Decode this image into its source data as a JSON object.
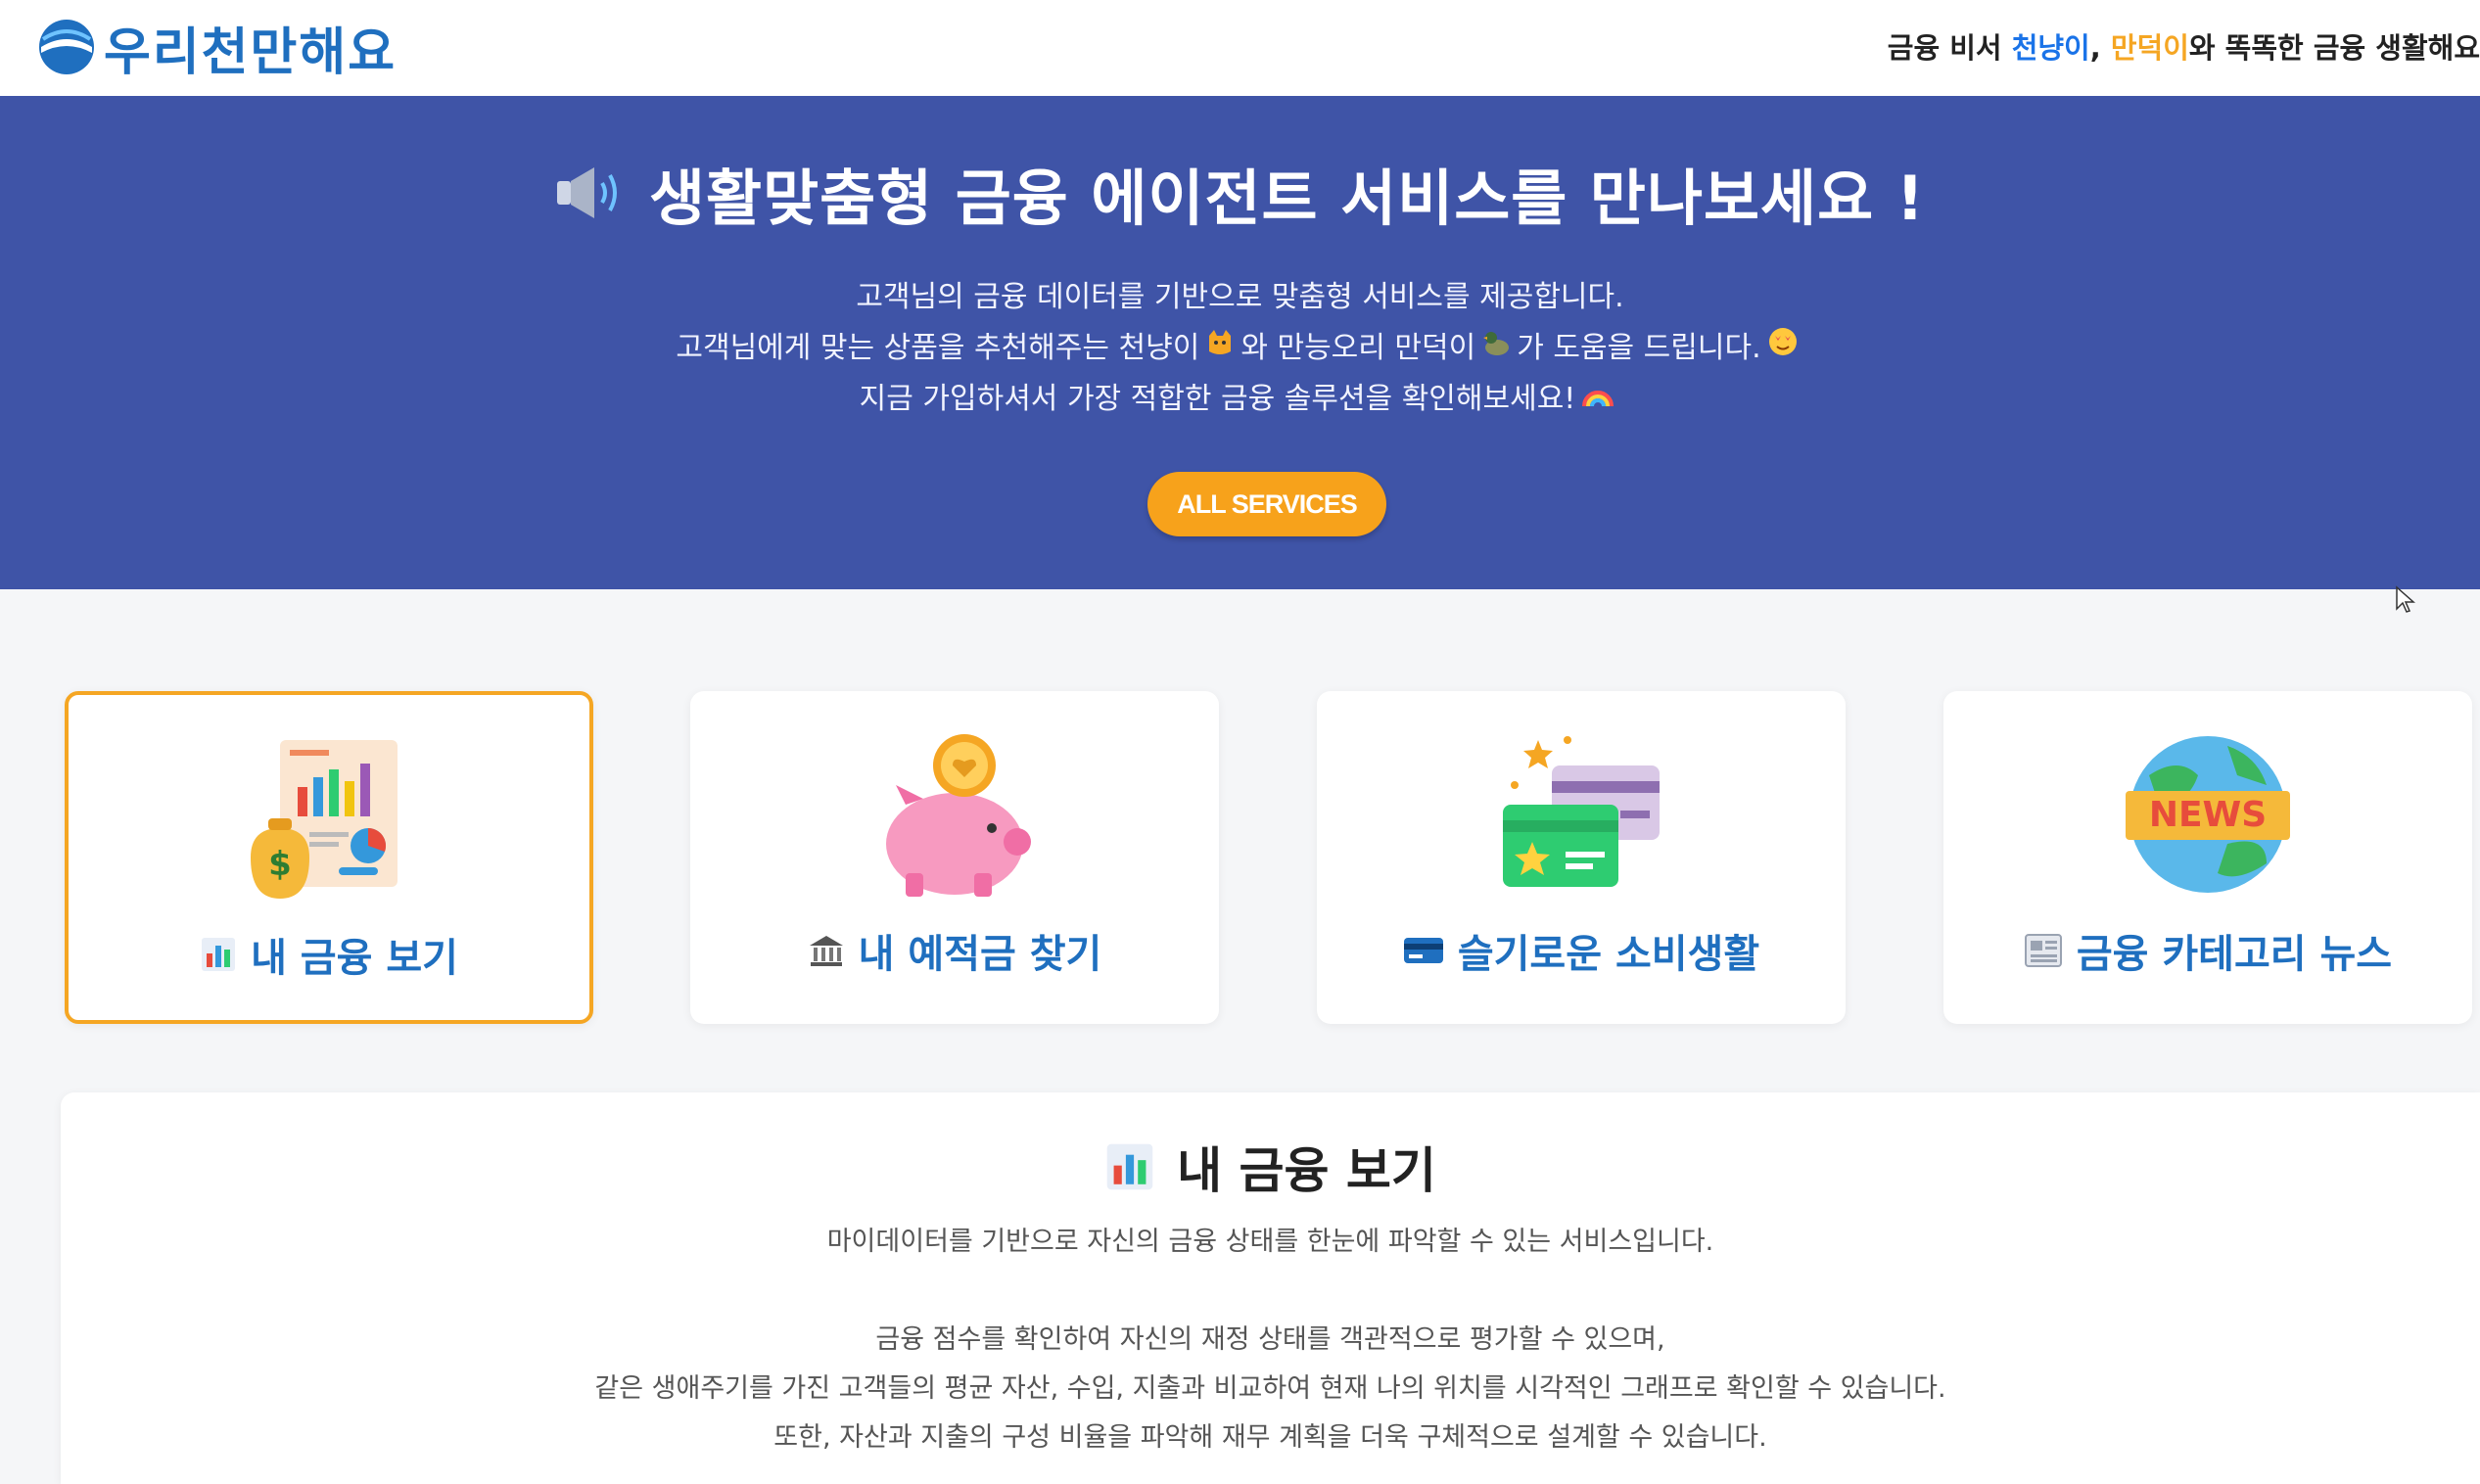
{
  "header": {
    "logo_text": "우리천만해요",
    "tagline": {
      "prefix": "금융 비서 ",
      "name1": "천냥이",
      "sep": ", ",
      "name2": "만덕이",
      "suffix": "와 똑똑한 금융 생활해요"
    }
  },
  "hero": {
    "title": "생활맞춤형 금융 에이전트 서비스를 만나보세요 !",
    "line1": "고객님의 금융 데이터를 기반으로 맞춤형 서비스를 제공합니다.",
    "line2_a": "고객님에게 맞는 상품을 추천해주는 천냥이",
    "line2_b": "와 만능오리 만덕이",
    "line2_c": "가 도움을 드립니다.",
    "line3": "지금 가입하셔서 가장 적합한 금융 솔루션을 확인해보세요!",
    "cta_label": "ALL SERVICES"
  },
  "cards": [
    {
      "label": "내 금융 보기",
      "icon": "bar-chart-icon",
      "illustration": "money-report-illustration",
      "selected": true
    },
    {
      "label": "내 예적금 찾기",
      "icon": "bank-icon",
      "illustration": "piggy-bank-illustration",
      "selected": false
    },
    {
      "label": "슬기로운 소비생활",
      "icon": "credit-card-icon",
      "illustration": "cards-illustration",
      "selected": false
    },
    {
      "label": "금융 카테고리 뉴스",
      "icon": "newspaper-icon",
      "illustration": "news-globe-illustration",
      "selected": false
    }
  ],
  "panel": {
    "title": "내 금융 보기",
    "subtitle": "마이데이터를 기반으로 자신의 금융 상태를 한눈에 파악할 수 있는 서비스입니다.",
    "body_line1": "금융 점수를 확인하여 자신의 재정 상태를 객관적으로 평가할 수 있으며,",
    "body_line2": "같은 생애주기를 가진 고객들의 평균 자산, 수입, 지출과 비교하여 현재 나의 위치를 시각적인 그래프로 확인할 수 있습니다.",
    "body_line3": "또한, 자산과 지출의 구성 비율을 파악해 재무 계획을 더욱 구체적으로 설계할 수 있습니다."
  },
  "colors": {
    "hero_bg": "#3f54a7",
    "accent": "#f5a623",
    "brand_blue": "#1f6fbf"
  }
}
